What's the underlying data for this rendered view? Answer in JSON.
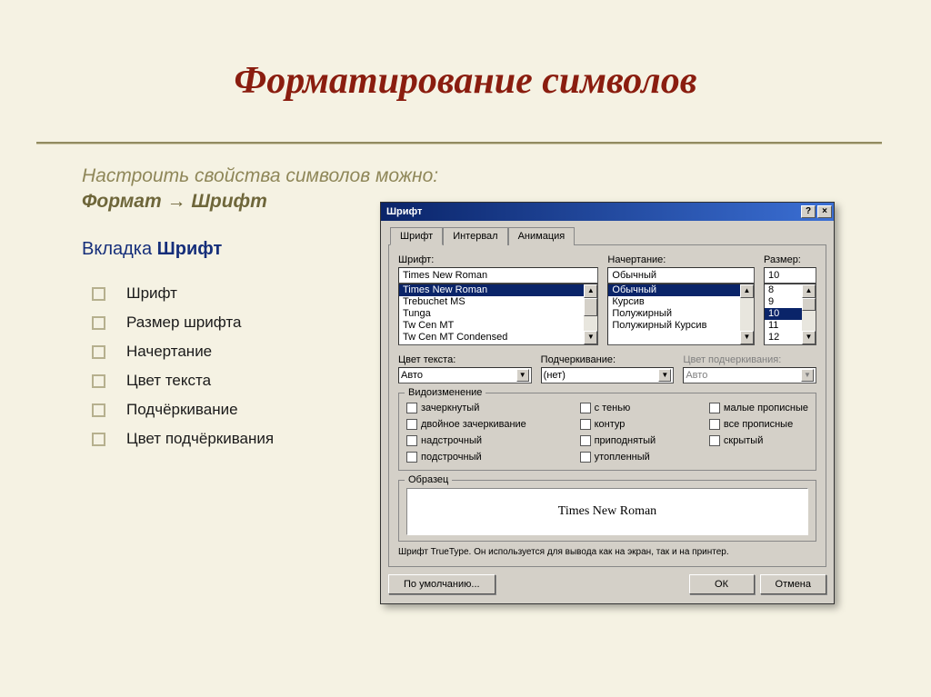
{
  "title": "Форматирование символов",
  "intro_line1": "Настроить свойства символов можно:",
  "intro_path": "Формат → Шрифт",
  "subhead_prefix": "Вкладка ",
  "subhead_bold": "Шрифт",
  "bullets": [
    "Шрифт",
    "Размер шрифта",
    "Начертание",
    "Цвет текста",
    "Подчёркивание",
    "Цвет подчёркивания"
  ],
  "dialog": {
    "title": "Шрифт",
    "help": "?",
    "close": "×",
    "tabs": {
      "font": "Шрифт",
      "spacing": "Интервал",
      "anim": "Анимация"
    },
    "labels": {
      "font": "Шрифт:",
      "style": "Начертание:",
      "size": "Размер:",
      "color": "Цвет текста:",
      "underline": "Подчеркивание:",
      "underline_color": "Цвет подчеркивания:",
      "effects": "Видоизменение",
      "preview": "Образец"
    },
    "font_input": "Times New Roman",
    "font_list": [
      "Times New Roman",
      "Trebuchet MS",
      "Tunga",
      "Tw Cen MT",
      "Tw Cen MT Condensed"
    ],
    "style_input": "Обычный",
    "style_list": [
      "Обычный",
      "Курсив",
      "Полужирный",
      "Полужирный Курсив"
    ],
    "size_input": "10",
    "size_list": [
      "8",
      "9",
      "10",
      "11",
      "12"
    ],
    "color_value": "Авто",
    "underline_value": "(нет)",
    "underline_color_value": "Авто",
    "effects": {
      "col1": [
        "зачеркнутый",
        "двойное зачеркивание",
        "надстрочный",
        "подстрочный"
      ],
      "col2": [
        "с тенью",
        "контур",
        "приподнятый",
        "утопленный"
      ],
      "col3": [
        "малые прописные",
        "все прописные",
        "скрытый"
      ]
    },
    "preview_text": "Times New Roman",
    "description": "Шрифт TrueType. Он используется для вывода как на экран, так и на принтер.",
    "buttons": {
      "default": "По умолчанию...",
      "ok": "ОК",
      "cancel": "Отмена"
    }
  }
}
